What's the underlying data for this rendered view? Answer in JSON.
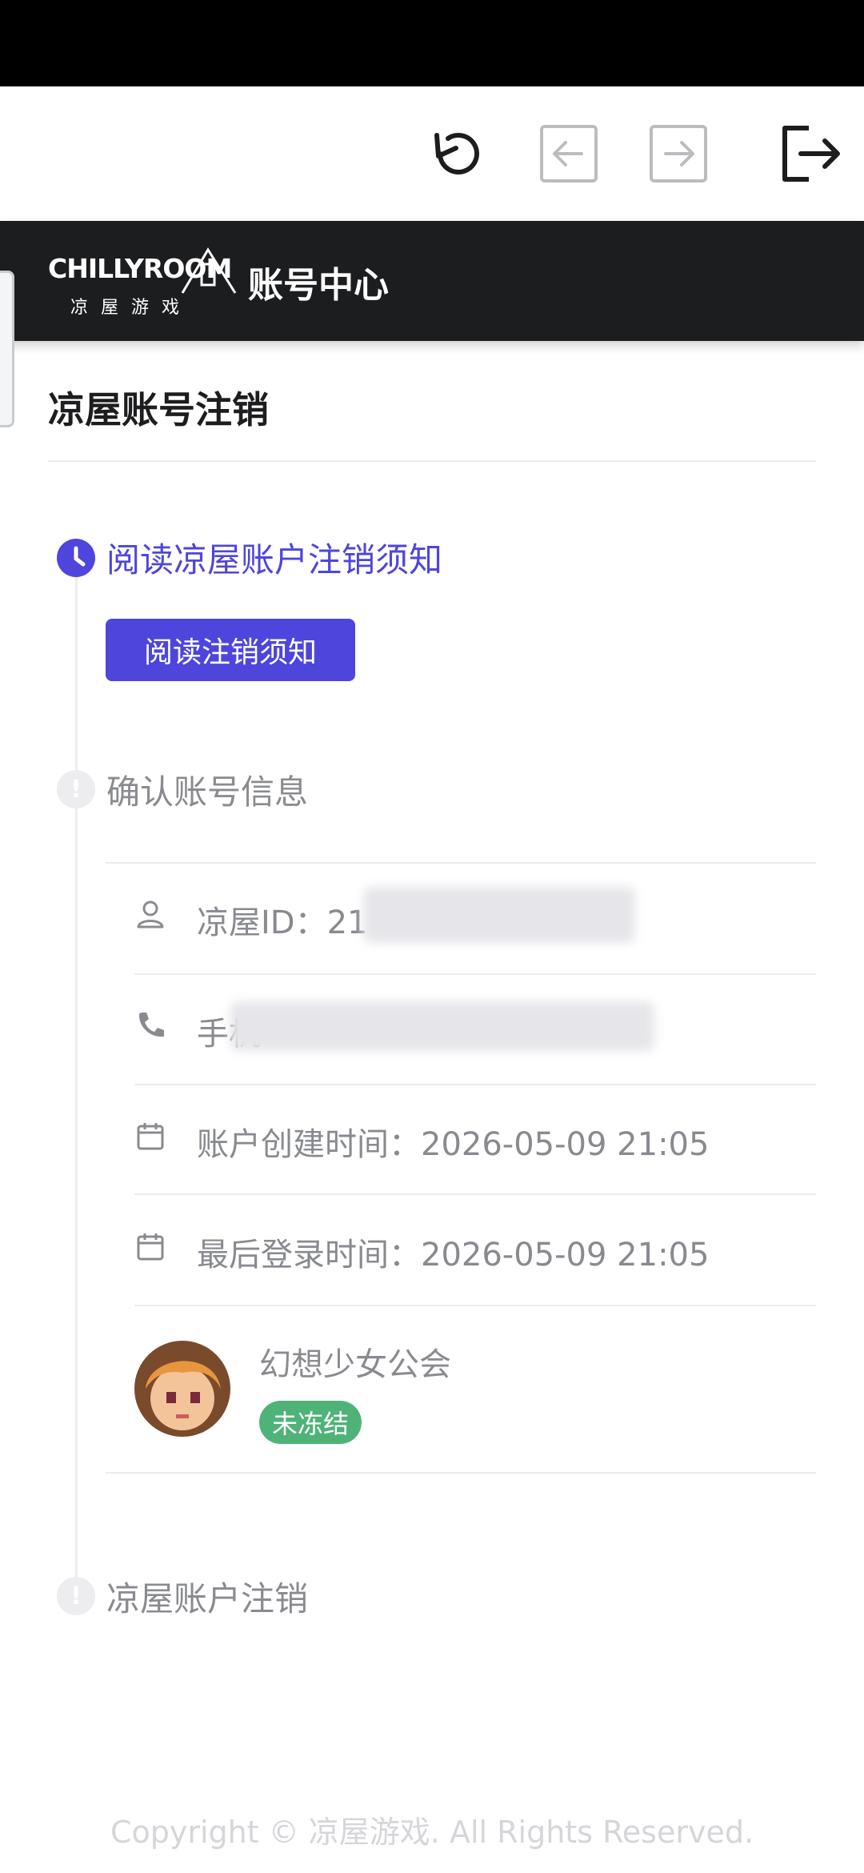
{
  "header": {
    "title": "账号中心",
    "logo_text": "CHILLYROOM",
    "logo_sub": "凉屋游戏"
  },
  "toolbar": {
    "refresh_icon": "refresh-icon",
    "back_icon": "arrow-left-icon",
    "forward_icon": "arrow-right-icon",
    "exit_icon": "logout-icon"
  },
  "page": {
    "title": "凉屋账号注销"
  },
  "steps": [
    {
      "title": "阅读凉屋账户注销须知",
      "state": "active",
      "button_label": "阅读注销须知"
    },
    {
      "title": "确认账号信息",
      "state": "pending"
    },
    {
      "title": "凉屋账户注销",
      "state": "pending"
    }
  ],
  "account_info": {
    "id_label": "凉屋ID：21",
    "phone_label": "手机",
    "created_label": "账户创建时间：2026-05-09 21:05",
    "last_login_label": "最后登录时间：2026-05-09 21:05"
  },
  "guild": {
    "name": "幻想少女公会",
    "status": "未冻结"
  },
  "footer": {
    "copyright": "Copyright © 凉屋游戏. All Rights Reserved."
  },
  "colors": {
    "accent": "#4e45dd",
    "success": "#4fb378",
    "header_bg": "#1c1d1f"
  }
}
